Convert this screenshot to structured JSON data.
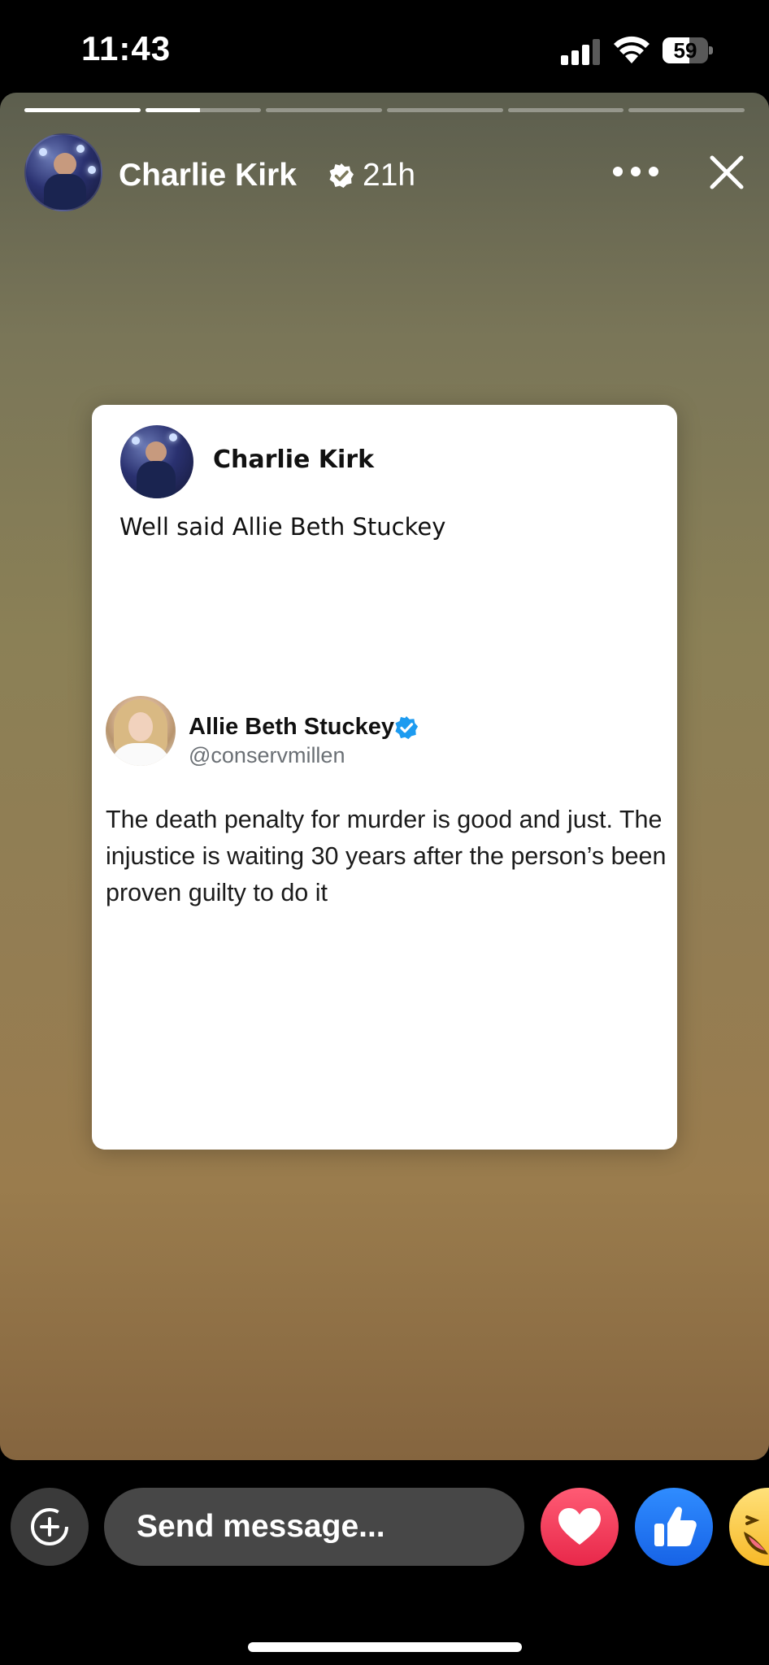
{
  "status_bar": {
    "time": "11:43",
    "battery_level": "59",
    "battery_fraction": 0.59,
    "signal_bars_active": 3,
    "signal_bars_total": 4
  },
  "story": {
    "segment_count": 6,
    "segments_fill": [
      1,
      0.47,
      0,
      0,
      0,
      0
    ],
    "author": "Charlie Kirk",
    "time_ago": "21h",
    "verified": true
  },
  "post_card": {
    "author": "Charlie Kirk",
    "caption": "Well said Allie Beth Stuckey",
    "quoted_tweet": {
      "name": "Allie Beth Stuckey",
      "handle": "@conservmillen",
      "verified": true,
      "verified_color": "#1d9bf0",
      "text": "The death penalty for murder is good and just. The injustice is waiting 30 years after the person’s been proven guilty to do it"
    }
  },
  "bottom_bar": {
    "message_placeholder": "Send message...",
    "reactions": [
      {
        "icon": "heart-icon",
        "color": "#f02849"
      },
      {
        "icon": "thumbs-up-icon",
        "color": "#1877f2"
      },
      {
        "icon": "laughing-face-icon",
        "color": "#f7b928"
      }
    ]
  },
  "icons": {
    "add": "add-circle-icon",
    "more": "more-dots-icon",
    "close": "close-icon",
    "verified": "verified-badge-icon"
  }
}
